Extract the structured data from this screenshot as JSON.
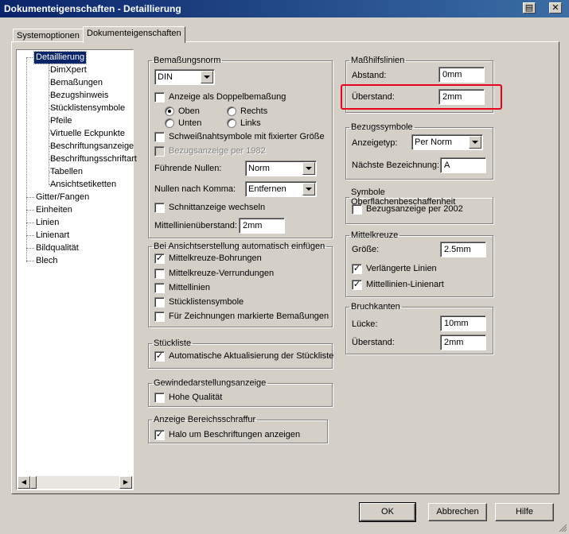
{
  "window": {
    "title": "Dokumenteigenschaften - Detaillierung",
    "highlight_color": "#e8001c"
  },
  "tabs": [
    {
      "label": "Systemoptionen",
      "active": false
    },
    {
      "label": "Dokumenteigenschaften",
      "active": true
    }
  ],
  "tree": {
    "items": [
      {
        "label": "Detaillierung",
        "selected": true
      },
      {
        "label": "DimXpert"
      },
      {
        "label": "Bemaßungen"
      },
      {
        "label": "Bezugshinweis"
      },
      {
        "label": "Stücklistensymbole"
      },
      {
        "label": "Pfeile"
      },
      {
        "label": "Virtuelle Eckpunkte"
      },
      {
        "label": "Beschriftungsanzeige"
      },
      {
        "label": "Beschriftungsschriftart"
      },
      {
        "label": "Tabellen"
      },
      {
        "label": "Ansichtsetiketten"
      },
      {
        "label": "Gitter/Fangen"
      },
      {
        "label": "Einheiten"
      },
      {
        "label": "Linien"
      },
      {
        "label": "Linienart"
      },
      {
        "label": "Bildqualität"
      },
      {
        "label": "Blech"
      }
    ]
  },
  "bemassungsnorm": {
    "legend": "Bemaßungsnorm",
    "norm_value": "DIN",
    "doppel_label": "Anzeige als Doppelbemaßung",
    "doppel_checked": false,
    "radio_oben": "Oben",
    "radio_rechts": "Rechts",
    "radio_unten": "Unten",
    "radio_links": "Links",
    "schweiss_label": "Schweißnahtsymbole mit fixierter Größe",
    "schweiss_checked": false,
    "bezug1982_label": "Bezugsanzeige per 1982",
    "bezug1982_checked": false,
    "fuehrende_label": "Führende Nullen:",
    "fuehrende_value": "Norm",
    "nullen_label": "Nullen nach Komma:",
    "nullen_value": "Entfernen",
    "schnitt_label": "Schnittanzeige wechseln",
    "schnitt_checked": false,
    "mittel_label": "Mittellinienüberstand:",
    "mittel_value": "2mm"
  },
  "ansicht": {
    "legend": "Bei Ansichtserstellung automatisch einfügen",
    "items": [
      {
        "label": "Mittelkreuze-Bohrungen",
        "checked": true
      },
      {
        "label": "Mittelkreuze-Verrundungen",
        "checked": false
      },
      {
        "label": "Mittellinien",
        "checked": false
      },
      {
        "label": "Stücklistensymbole",
        "checked": false
      },
      {
        "label": "Für Zeichnungen markierte Bemaßungen",
        "checked": false
      }
    ]
  },
  "stueckliste": {
    "legend": "Stückliste",
    "auto_label": "Automatische Aktualisierung der Stückliste",
    "auto_checked": true
  },
  "gewinde": {
    "legend": "Gewindedarstellungsanzeige",
    "hohe_label": "Hohe Qualität",
    "hohe_checked": false
  },
  "bereich": {
    "legend": "Anzeige Bereichsschraffur",
    "halo_label": "Halo um Beschriftungen anzeigen",
    "halo_checked": true
  },
  "masshilfslinien": {
    "legend": "Maßhilfslinien",
    "abstand_label": "Abstand:",
    "abstand_value": "0mm",
    "ueberstand_label": "Überstand:",
    "ueberstand_value": "2mm"
  },
  "bezugssymbole": {
    "legend": "Bezugssymbole",
    "anzeigetyp_label": "Anzeigetyp:",
    "anzeigetyp_value": "Per Norm",
    "naechste_label": "Nächste Bezeichnung:",
    "naechste_value": "A"
  },
  "oberflaeche": {
    "legend": "Symbole Oberflächenbeschaffenheit",
    "bezug2002_label": "Bezugsanzeige per 2002",
    "bezug2002_checked": false
  },
  "mittelkreuze": {
    "legend": "Mittelkreuze",
    "groesse_label": "Größe:",
    "groesse_value": "2.5mm",
    "verl_label": "Verlängerte Linien",
    "verl_checked": true,
    "linienart_label": "Mittellinien-Linienart",
    "linienart_checked": true
  },
  "bruchkanten": {
    "legend": "Bruchkanten",
    "luecke_label": "Lücke:",
    "luecke_value": "10mm",
    "ueberstand_label": "Überstand:",
    "ueberstand_value": "2mm"
  },
  "buttons": {
    "ok": "OK",
    "abbrechen": "Abbrechen",
    "hilfe": "Hilfe"
  }
}
